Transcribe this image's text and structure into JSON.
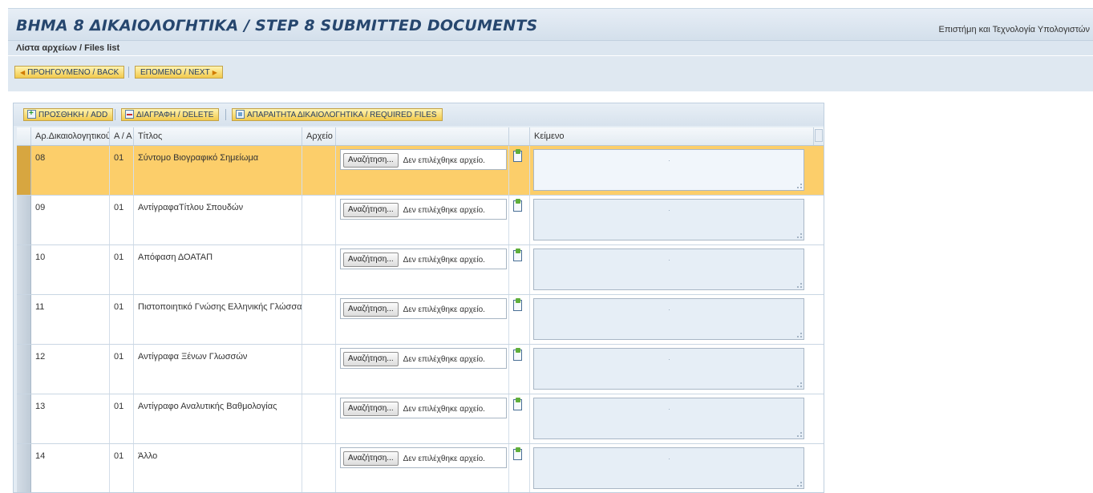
{
  "header": {
    "title": "ΒΗΜΑ 8 ΔΙΚΑΙΟΛΟΓΗΤΙΚΑ / STEP 8 SUBMITTED DOCUMENTS",
    "program": "Επιστήμη και Τεχνολογία Υπολογιστών"
  },
  "subtitle": "Λίστα αρχείων / Files list",
  "nav": {
    "back_label": "ΠΡΟΗΓΟΥΜΕΝΟ / BACK",
    "next_label": "ΕΠΟΜΕΝΟ / NEXT"
  },
  "toolbar": {
    "add_label": "ΠΡΟΣΘΗΚΗ / ADD",
    "delete_label": "ΔΙΑΓΡΑΦΗ / DELETE",
    "required_label": "ΑΠΑΡΑΙΤΗΤΑ ΔΙΚΑΙΟΛΟΓΗΤΙΚΑ / REQUIRED FILES"
  },
  "columns": {
    "doc_no": "Αρ.Δικαιολογητικού",
    "seq": "Α / Α",
    "title": "Τίτλος",
    "file": "Αρχείο",
    "text": "Κείμενο"
  },
  "file_input": {
    "browse_label": "Αναζήτηση...",
    "no_file_label": "Δεν επιλέχθηκε αρχείο."
  },
  "icons": {
    "add": "add-document-icon",
    "delete": "delete-document-icon",
    "required": "required-files-icon",
    "attach": "attach-file-icon"
  },
  "colors": {
    "selected_row": "#fcce6a",
    "title_text": "#26466e",
    "button_fill": "#f2c94c"
  },
  "rows": [
    {
      "doc_no": "08",
      "seq": "01",
      "title": "Σύντομο Βιογραφικό Σημείωμα",
      "selected": true
    },
    {
      "doc_no": "09",
      "seq": "01",
      "title": "ΑντίγραφαΤίτλου Σπουδών",
      "selected": false
    },
    {
      "doc_no": "10",
      "seq": "01",
      "title": "Απόφαση ΔΟΑΤΑΠ",
      "selected": false
    },
    {
      "doc_no": "11",
      "seq": "01",
      "title": "Πιστοποιητικό Γνώσης Ελληνικής Γλώσσας",
      "selected": false
    },
    {
      "doc_no": "12",
      "seq": "01",
      "title": "Αντίγραφα Ξένων Γλωσσών",
      "selected": false
    },
    {
      "doc_no": "13",
      "seq": "01",
      "title": "Αντίγραφο Αναλυτικής Βαθμολογίας",
      "selected": false
    },
    {
      "doc_no": "14",
      "seq": "01",
      "title": "Άλλο",
      "selected": false
    }
  ]
}
